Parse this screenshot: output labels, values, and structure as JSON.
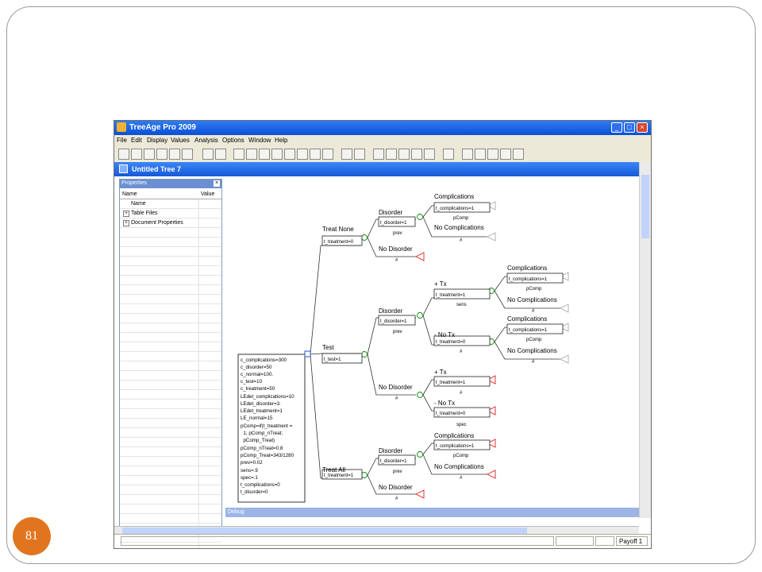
{
  "slide": {
    "page_number": "81"
  },
  "app": {
    "title": "TreeAge Pro 2009",
    "menu": [
      "File",
      "Edit",
      "Display",
      "Values",
      "Analysis",
      "Options",
      "Window",
      "Help"
    ],
    "document_title": "Untitled Tree 7",
    "status_right": "Payoff 1"
  },
  "properties_panel": {
    "title": "Properties",
    "columns": [
      "Name",
      "Value"
    ],
    "items": [
      "Name",
      "Table Files",
      "Document Properties"
    ]
  },
  "debug": {
    "label": "Debug"
  },
  "tree": {
    "root_definitions": [
      "c_complications=300",
      "c_disorder=50",
      "c_normal=100.",
      "c_test=10",
      "c_treatment=50",
      "LEdet_complications=10",
      "LEdet_disorder=3.",
      "LEdet_treatment=1",
      "LE_normal=15",
      "pComp=if(t_treatment =",
      "  1; pComp_nTreat;",
      "  pComp_Treat)",
      "pComp_nTreat=0.8",
      "pComp_Treat=343/1280",
      "prev=0.02",
      "sens=.9",
      "spec=.1",
      "t_complications=0",
      "t_disorder=0"
    ],
    "treat_none": {
      "label": "Treat None",
      "def": "t_treatment=0",
      "disorder": {
        "label": "Disorder",
        "def": "t_disorder=1",
        "prob": "prev",
        "comp": {
          "label": "Complications",
          "def": "t_complications=1",
          "prob": "pComp"
        },
        "nocomp": {
          "label": "No Complications",
          "prob": "#"
        }
      },
      "no_disorder": {
        "label": "No Disorder",
        "prob": "#"
      }
    },
    "test": {
      "label": "Test",
      "def": "t_test=1",
      "disorder": {
        "label": "Disorder",
        "def": "t_disorder=1",
        "prob": "prev",
        "pos": {
          "label": "+ Tx",
          "def": "t_treatment=1",
          "prob": "sens",
          "comp": {
            "label": "Complications",
            "def": "t_complications=1",
            "prob": "pComp"
          },
          "nocomp": {
            "label": "No Complications",
            "prob": "#"
          }
        },
        "neg": {
          "label": "- No Tx",
          "def": "t_treatment=0",
          "prob": "#",
          "comp": {
            "label": "Complications",
            "def": "t_complications=1",
            "prob": "pComp"
          },
          "nocomp": {
            "label": "No Complications",
            "prob": "#"
          }
        }
      },
      "no_disorder": {
        "label": "No Disorder",
        "prob": "#",
        "pos": {
          "label": "+ Tx",
          "def": "t_treatment=1",
          "prob": "#"
        },
        "neg": {
          "label": "- No Tx",
          "def": "t_treatment=0",
          "prob": "spec"
        }
      }
    },
    "treat_all": {
      "label": "Treat All",
      "def": "t_treatment=1",
      "disorder": {
        "label": "Disorder",
        "def": "t_disorder=1",
        "prob": "prev",
        "comp": {
          "label": "Complications",
          "def": "t_complications=1",
          "prob": "pComp"
        },
        "nocomp": {
          "label": "No Complications",
          "prob": "#"
        }
      },
      "no_disorder": {
        "label": "No Disorder",
        "prob": "#"
      }
    }
  }
}
